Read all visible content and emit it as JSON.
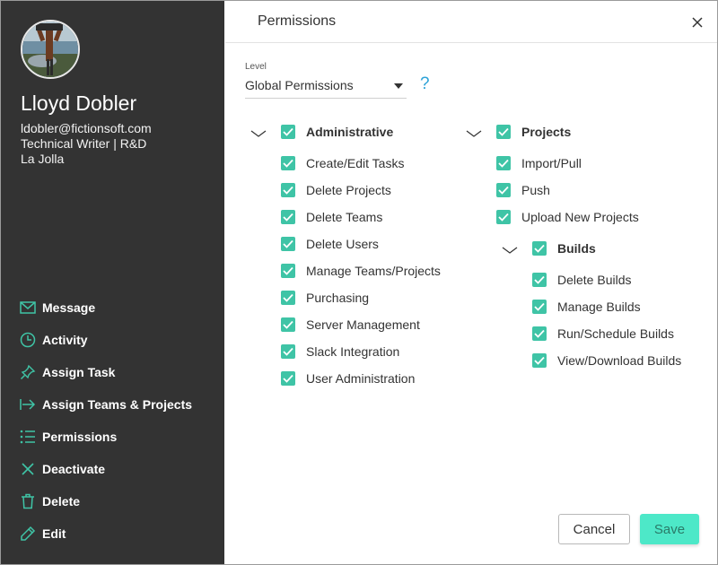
{
  "colors": {
    "sidebar_bg": "#333333",
    "accent": "#3fc4a6",
    "save_bg": "#4de8c8",
    "help": "#2ea3d8"
  },
  "profile": {
    "name": "Lloyd Dobler",
    "email": "ldobler@fictionsoft.com",
    "role": "Technical Writer | R&D",
    "location": "La Jolla"
  },
  "menu": [
    {
      "label": "Message",
      "icon": "envelope-icon"
    },
    {
      "label": "Activity",
      "icon": "clock-icon"
    },
    {
      "label": "Assign Task",
      "icon": "pin-icon"
    },
    {
      "label": "Assign Teams & Projects",
      "icon": "arrow-right-icon"
    },
    {
      "label": "Permissions",
      "icon": "list-icon"
    },
    {
      "label": "Deactivate",
      "icon": "x-icon"
    },
    {
      "label": "Delete",
      "icon": "trash-icon"
    },
    {
      "label": "Edit",
      "icon": "pencil-icon"
    }
  ],
  "panel": {
    "title": "Permissions",
    "level_label": "Level",
    "level_value": "Global Permissions",
    "help": "?"
  },
  "groups": {
    "administrative": {
      "label": "Administrative",
      "checked": true,
      "items": [
        {
          "label": "Create/Edit Tasks",
          "checked": true
        },
        {
          "label": "Delete Projects",
          "checked": true
        },
        {
          "label": "Delete Teams",
          "checked": true
        },
        {
          "label": "Delete Users",
          "checked": true
        },
        {
          "label": "Manage Teams/Projects",
          "checked": true
        },
        {
          "label": "Purchasing",
          "checked": true
        },
        {
          "label": "Server Management",
          "checked": true
        },
        {
          "label": "Slack Integration",
          "checked": true
        },
        {
          "label": "User Administration",
          "checked": true
        }
      ]
    },
    "projects": {
      "label": "Projects",
      "checked": true,
      "items": [
        {
          "label": "Import/Pull",
          "checked": true
        },
        {
          "label": "Push",
          "checked": true
        },
        {
          "label": "Upload New Projects",
          "checked": true
        }
      ]
    },
    "builds": {
      "label": "Builds",
      "checked": true,
      "items": [
        {
          "label": "Delete Builds",
          "checked": true
        },
        {
          "label": "Manage Builds",
          "checked": true
        },
        {
          "label": "Run/Schedule Builds",
          "checked": true
        },
        {
          "label": "View/Download Builds",
          "checked": true
        }
      ]
    }
  },
  "buttons": {
    "cancel": "Cancel",
    "save": "Save"
  }
}
